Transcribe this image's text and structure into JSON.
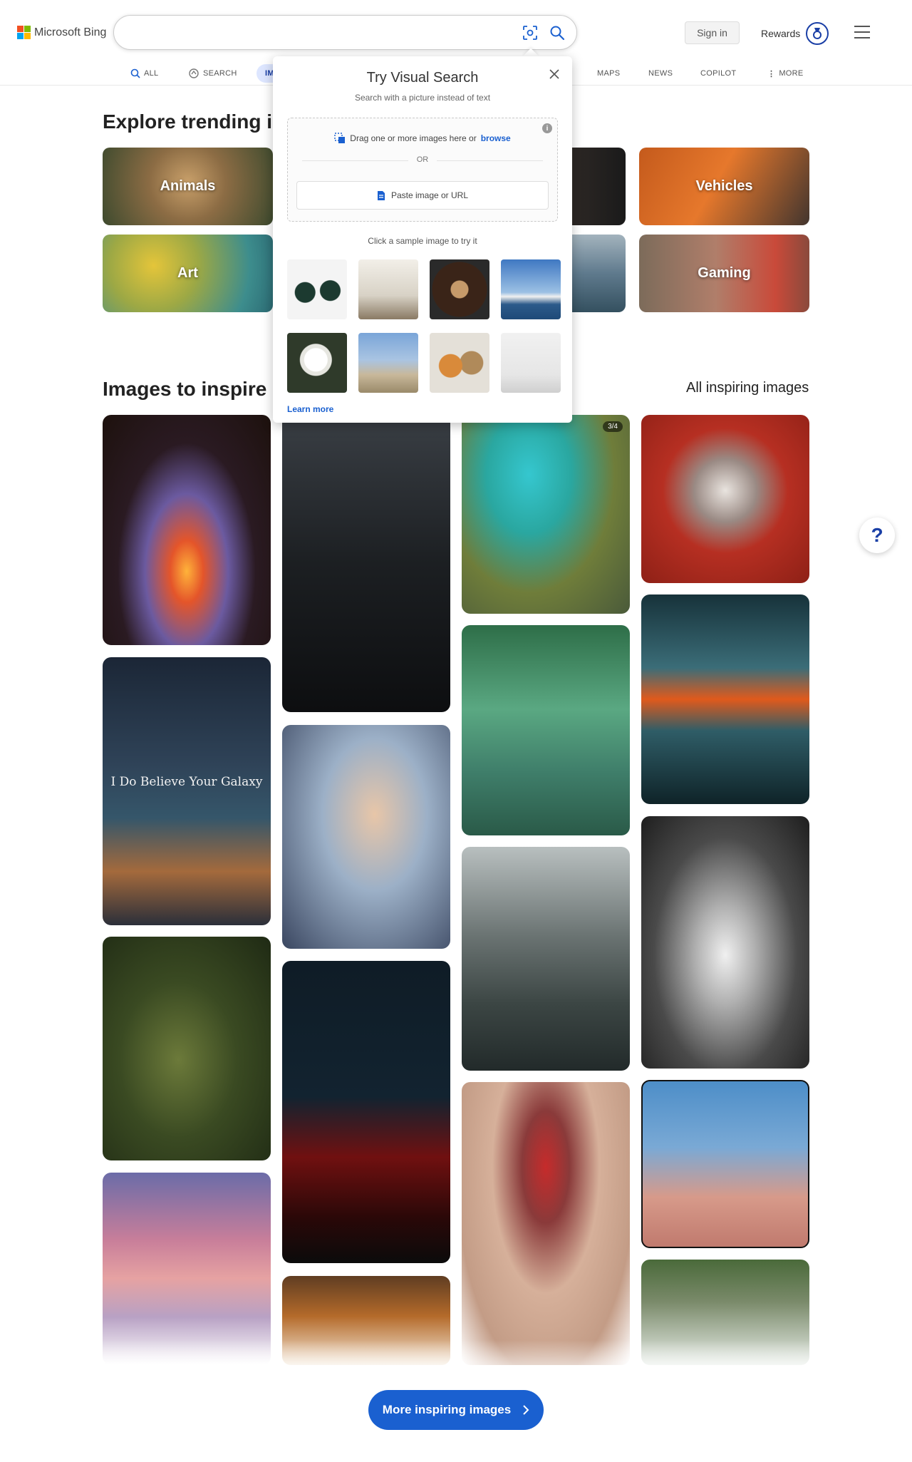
{
  "header": {
    "logo_text": "Microsoft Bing",
    "search_placeholder": "",
    "sign_in": "Sign in",
    "rewards": "Rewards"
  },
  "nav": {
    "items": [
      {
        "label": "ALL",
        "icon": "search-icon"
      },
      {
        "label": "SEARCH",
        "icon": "copilot-search-icon"
      },
      {
        "label": "IM",
        "icon": "image-icon",
        "active": true
      },
      {
        "label": "MAPS"
      },
      {
        "label": "NEWS"
      },
      {
        "label": "COPILOT"
      },
      {
        "label": "MORE",
        "icon": "more-vertical-icon"
      }
    ]
  },
  "trending": {
    "title": "Explore trending i",
    "tiles": [
      "Animals",
      "Vehicles",
      "Art",
      "Gaming"
    ]
  },
  "inspire": {
    "title": "Images to inspire",
    "all_link": "All inspiring images",
    "counter": "3/4",
    "galaxy_caption": "I Do Believe Your Galaxy",
    "more_button": "More inspiring images"
  },
  "visual_search": {
    "title": "Try Visual Search",
    "subtitle": "Search with a picture instead of text",
    "drag_text": "Drag one or more images here or",
    "browse": "browse",
    "or": "OR",
    "paste": "Paste image or URL",
    "sample_heading": "Click a sample image to try it",
    "learn_more": "Learn more",
    "samples": [
      "sunglasses",
      "dining room",
      "latte art",
      "sydney opera house",
      "white rose",
      "louvre pyramid",
      "corgi and yorkie",
      "white chair"
    ]
  },
  "colors": {
    "accent": "#1a60d0",
    "brand_navy": "#1a3fa6",
    "ms_red": "#f25022",
    "ms_green": "#7fba00",
    "ms_blue": "#00a4ef",
    "ms_yellow": "#ffb900"
  }
}
